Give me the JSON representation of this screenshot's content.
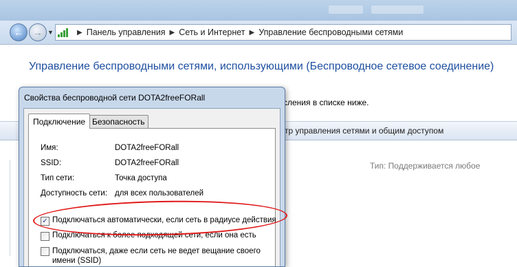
{
  "address_bar": {
    "crumbs": [
      "Панель управления",
      "Сеть и Интернет",
      "Управление беспроводными сетями"
    ]
  },
  "main": {
    "heading": "Управление беспроводными сетями, использующими (Беспроводное сетевое соединение)",
    "description_tail": "сления в списке ниже.",
    "command_link": "тр управления сетями и общим доступом",
    "type_line": "Тип:  Поддерживается любое"
  },
  "dialog": {
    "title": "Свойства беспроводной сети DOTA2freeFORall",
    "tabs": [
      {
        "label": "Подключение",
        "active": true
      },
      {
        "label": "Безопасность",
        "active": false
      }
    ],
    "properties": [
      {
        "label": "Имя:",
        "value": "DOTA2freeFORall"
      },
      {
        "label": "SSID:",
        "value": "DOTA2freeFORall"
      },
      {
        "label": "Тип сети:",
        "value": "Точка доступа"
      },
      {
        "label": "Доступность сети:",
        "value": "для всех пользователей"
      }
    ],
    "options": [
      {
        "label": "Подключаться автоматически, если сеть в радиусе действия",
        "checked": true
      },
      {
        "label": "Подключаться к более подходящей сети, если она есть",
        "checked": false
      },
      {
        "label": "Подключаться, даже если сеть не ведет вещание своего",
        "label_line2": "имени (SSID)",
        "checked": false
      }
    ]
  },
  "colors": {
    "heading": "#1e4fa0",
    "highlight": "#e01919"
  }
}
